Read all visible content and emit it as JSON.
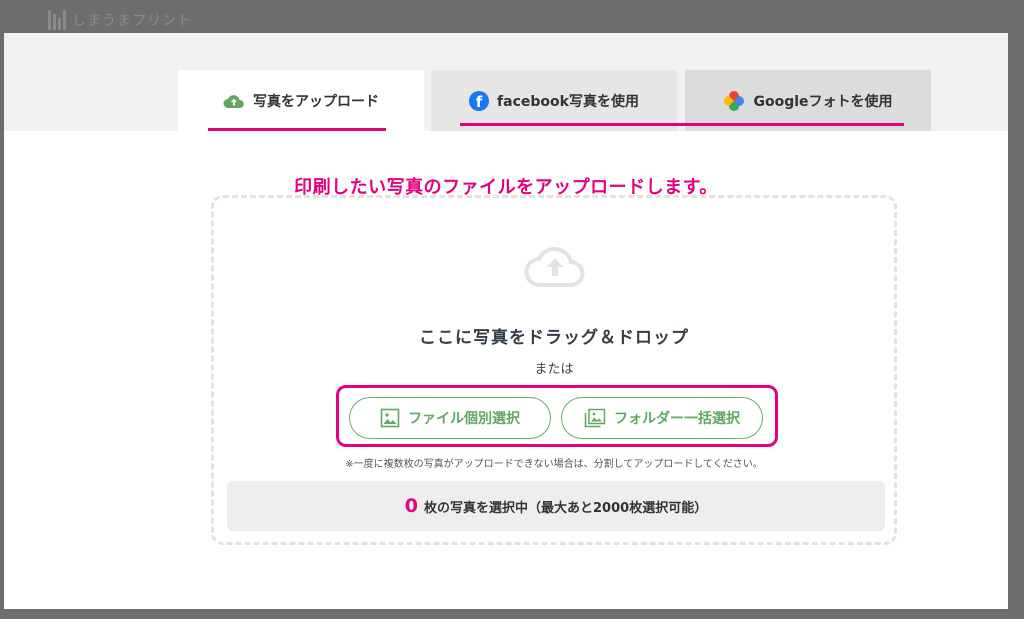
{
  "site": {
    "logo_text": "しまうまプリント"
  },
  "tabs": [
    {
      "label": "写真をアップロード",
      "icon": "cloud-upload-icon",
      "active": true
    },
    {
      "label": "facebook写真を使用",
      "icon": "facebook-icon"
    },
    {
      "label": "Googleフォトを使用",
      "icon": "google-photos-icon"
    }
  ],
  "main": {
    "heading": "印刷したい写真のファイルをアップロードします。",
    "drop_text": "ここに写真をドラッグ＆ドロップ",
    "or_text": "または",
    "file_button": "ファイル個別選択",
    "folder_button": "フォルダー一括選択",
    "note": "※一度に複数枚の写真がアップロードできない場合は、分割してアップロードしてください。",
    "status": {
      "count": "0",
      "text": "枚の写真を選択中（最大あと2000枚選択可能）"
    }
  },
  "colors": {
    "accent": "#e4007f",
    "green": "#5fa85f",
    "facebook": "#1877f2"
  }
}
